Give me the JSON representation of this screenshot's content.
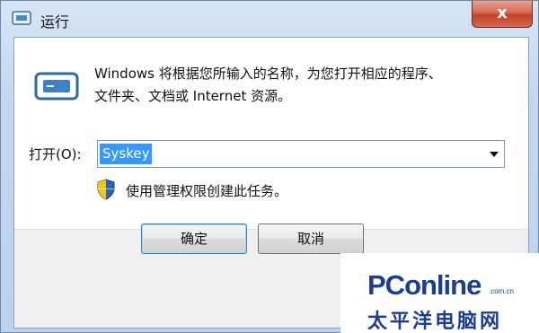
{
  "window": {
    "title": "运行",
    "close_glyph": "x"
  },
  "description": {
    "line1": "Windows 将根据您所输入的名称，为您打开相应的程序、",
    "line2": "文件夹、文档或 Internet 资源。"
  },
  "open_field": {
    "label": "打开(O):",
    "value": "Syskey"
  },
  "admin_note": "使用管理权限创建此任务。",
  "buttons": {
    "ok": "确定",
    "cancel": "取消"
  },
  "watermark": {
    "logo": "PConline",
    "domain": ".com.cn",
    "subtitle": "太平洋电脑网"
  },
  "colors": {
    "selection": "#3399ff",
    "close_button": "#c2412a",
    "brand": "#1b3d94"
  },
  "icons": [
    "run-program-icon",
    "close-icon",
    "dropdown-arrow-icon",
    "uac-shield-icon"
  ]
}
